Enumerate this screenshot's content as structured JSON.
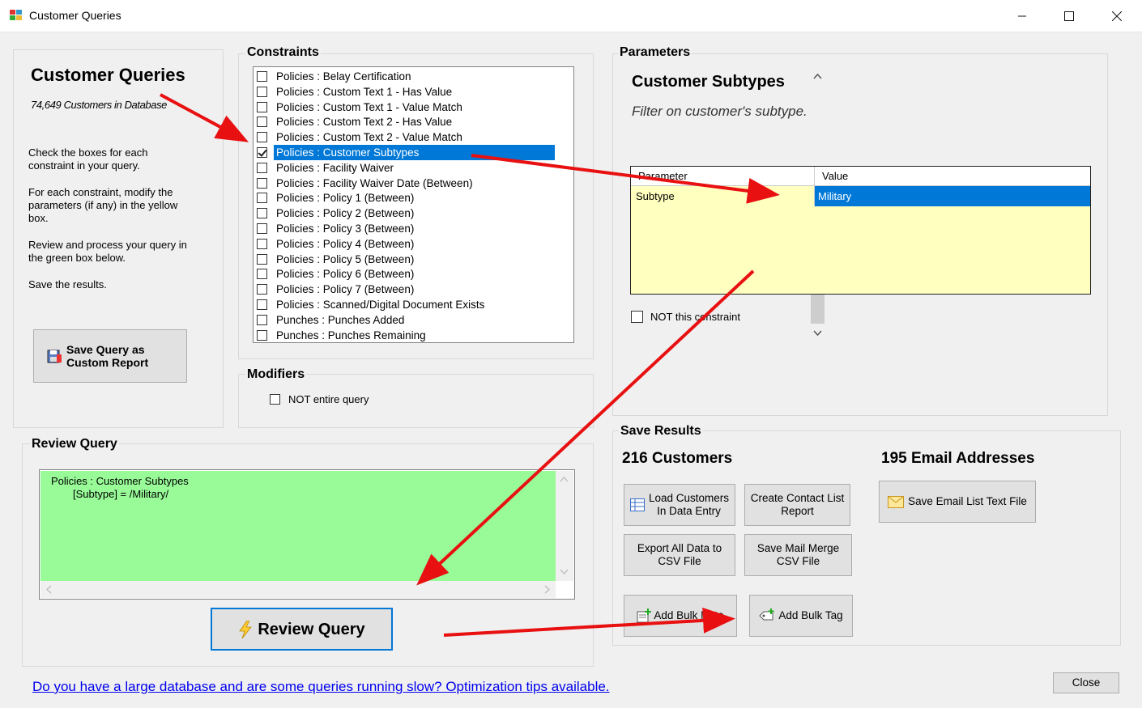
{
  "window": {
    "title": "Customer Queries",
    "minimize": "—",
    "maximize": "☐",
    "close": "✕"
  },
  "left_panel": {
    "title": "Customer Queries",
    "customer_count": "74,649 Customers in Database",
    "instructions": [
      "Check the boxes for each constraint  in your query.",
      "For each constraint, modify the parameters (if any) in the yellow box.",
      "Review and process your query in the green box below.",
      "Save the results."
    ],
    "save_query_button": {
      "line1": "Save Query as",
      "line2": "Custom Report"
    }
  },
  "constraints": {
    "title": "Constraints",
    "items": [
      {
        "label": "Policies : Belay Certification",
        "checked": false,
        "selected": false
      },
      {
        "label": "Policies : Custom Text 1 - Has Value",
        "checked": false,
        "selected": false
      },
      {
        "label": "Policies : Custom Text 1 - Value Match",
        "checked": false,
        "selected": false
      },
      {
        "label": "Policies : Custom Text 2 - Has Value",
        "checked": false,
        "selected": false
      },
      {
        "label": "Policies : Custom Text 2 - Value Match",
        "checked": false,
        "selected": false
      },
      {
        "label": "Policies : Customer Subtypes",
        "checked": true,
        "selected": true
      },
      {
        "label": "Policies : Facility Waiver",
        "checked": false,
        "selected": false
      },
      {
        "label": "Policies : Facility Waiver Date (Between)",
        "checked": false,
        "selected": false
      },
      {
        "label": "Policies : Policy 1 (Between)",
        "checked": false,
        "selected": false
      },
      {
        "label": "Policies : Policy 2 (Between)",
        "checked": false,
        "selected": false
      },
      {
        "label": "Policies : Policy 3 (Between)",
        "checked": false,
        "selected": false
      },
      {
        "label": "Policies : Policy 4 (Between)",
        "checked": false,
        "selected": false
      },
      {
        "label": "Policies : Policy 5 (Between)",
        "checked": false,
        "selected": false
      },
      {
        "label": "Policies : Policy 6 (Between)",
        "checked": false,
        "selected": false
      },
      {
        "label": "Policies : Policy 7 (Between)",
        "checked": false,
        "selected": false
      },
      {
        "label": "Policies : Scanned/Digital Document Exists",
        "checked": false,
        "selected": false
      },
      {
        "label": "Punches : Punches Added",
        "checked": false,
        "selected": false
      },
      {
        "label": "Punches : Punches Remaining",
        "checked": false,
        "selected": false
      }
    ]
  },
  "modifiers": {
    "title": "Modifiers",
    "not_entire_query": "NOT entire query"
  },
  "parameters": {
    "title": "Parameters",
    "heading": "Customer Subtypes",
    "description": "Filter on customer's subtype.",
    "grid_headers": [
      "Parameter",
      "Value"
    ],
    "grid_rows": [
      {
        "parameter": "Subtype",
        "value": "Military"
      }
    ],
    "not_constraint": "NOT this constraint"
  },
  "review": {
    "title": "Review Query",
    "query_line1": "Policies : Customer Subtypes",
    "query_line2": "[Subtype] = /Military/",
    "button": "Review Query"
  },
  "save_results": {
    "title": "Save Results",
    "customers": "216 Customers",
    "emails": "195 Email Addresses",
    "load_customers": {
      "line1": "Load Customers",
      "line2": "In Data Entry"
    },
    "create_contact": {
      "line1": "Create Contact List",
      "line2": "Report"
    },
    "export_all": {
      "line1": "Export All Data to",
      "line2": "CSV File"
    },
    "save_mail_merge": {
      "line1": "Save Mail Merge",
      "line2": "CSV File"
    },
    "add_bulk_note": "Add Bulk Note",
    "add_bulk_tag": "Add Bulk Tag",
    "save_email_list": "Save Email List Text File"
  },
  "footer": {
    "optimization_link": "Do you have a large database and are some queries running slow?  Optimization tips available.",
    "close_button": "Close"
  },
  "colors": {
    "selection": "#0078d7",
    "parameter_bg": "#ffffc0",
    "review_bg": "#98fb98",
    "arrow": "#e81010",
    "link": "#0000ee"
  }
}
